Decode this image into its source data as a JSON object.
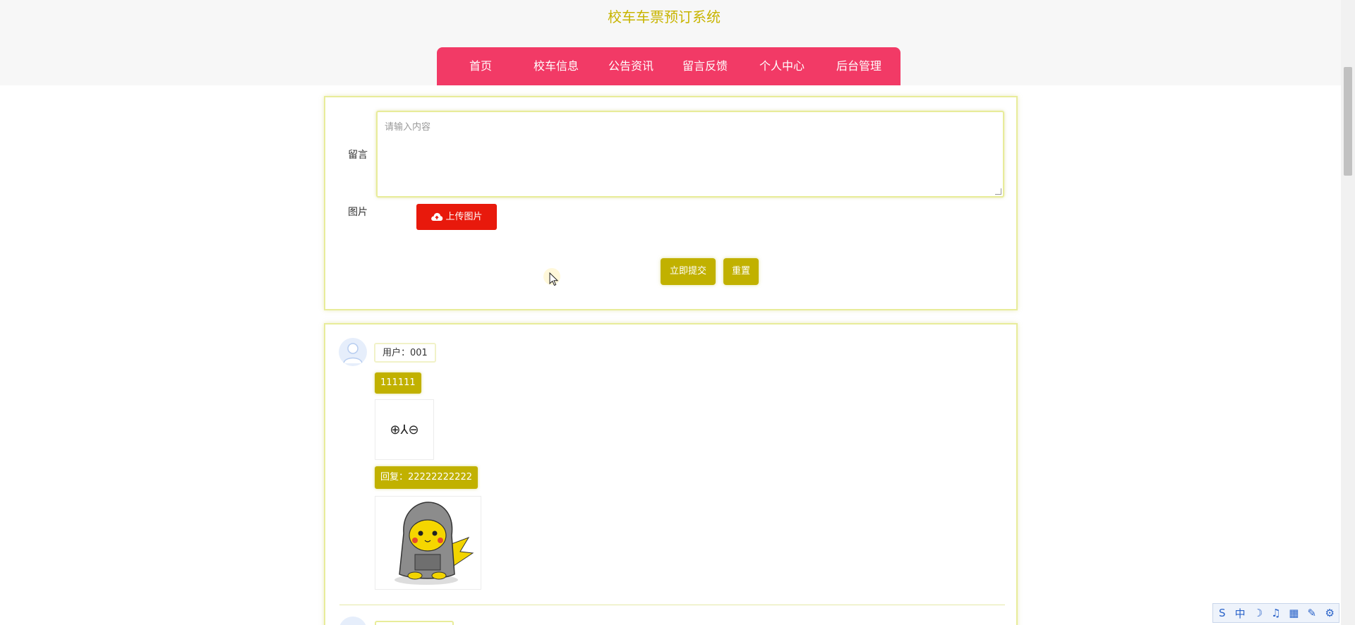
{
  "site": {
    "title": "校车车票预订系统"
  },
  "nav": {
    "items": [
      "首页",
      "校车信息",
      "公告资讯",
      "留言反馈",
      "个人中心",
      "后台管理"
    ]
  },
  "form": {
    "message_label": "留言",
    "message_placeholder": "请输入内容",
    "image_label": "图片",
    "upload_button": "上传图片",
    "submit_button": "立即提交",
    "reset_button": "重置"
  },
  "comments": [
    {
      "user": "用户：001",
      "content": "111111",
      "image_text": "⊕⅄⊖",
      "reply": "回复：22222222222"
    }
  ],
  "ime_toolbar": {
    "icons": [
      "sogou-icon",
      "chinese-mode-icon",
      "moon-icon",
      "note-icon",
      "keyboard-icon",
      "skin-icon",
      "tool-icon"
    ],
    "labels": [
      "S",
      "中",
      "☽",
      "♫",
      "▦",
      "✎",
      "⚙"
    ]
  },
  "colors": {
    "accent": "#c1b100",
    "nav": "#f23a66",
    "upload": "#e8190c",
    "title": "#c8b400"
  }
}
